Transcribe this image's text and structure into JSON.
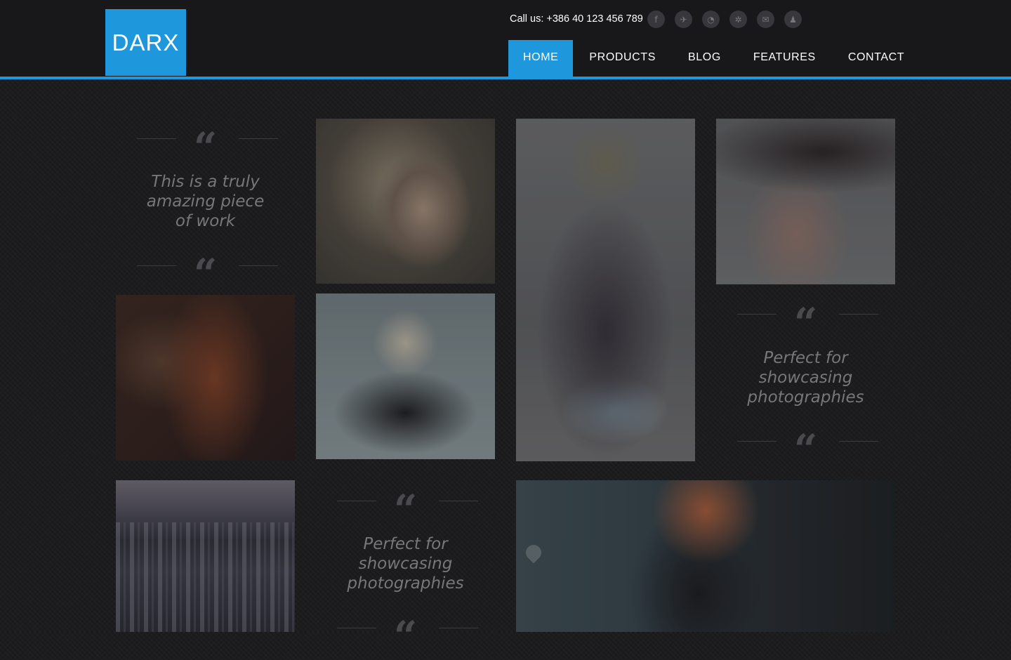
{
  "header": {
    "logo": "DARX",
    "call_us": "Call us: +386 40 123 456 789",
    "social_icons": [
      "facebook-icon",
      "twitter-icon",
      "rss-icon",
      "flickr-icon",
      "email-icon",
      "myspace-icon"
    ],
    "social_glyphs": [
      "f",
      "✈",
      "◔",
      "✲",
      "✉",
      "♟"
    ]
  },
  "nav": {
    "items": [
      "HOME",
      "PRODUCTS",
      "BLOG",
      "FEATURES",
      "CONTACT"
    ],
    "active": "HOME"
  },
  "quotes": [
    {
      "text_lines": [
        "This is a truly",
        "amazing piece",
        "of work"
      ]
    },
    {
      "text_lines": [
        "Perfect for",
        "showcasing",
        "photographies"
      ]
    },
    {
      "text_lines": [
        "Perfect for",
        "showcasing",
        "photographies"
      ]
    }
  ],
  "colors": {
    "accent": "#1f97dd",
    "header_bg": "#18181b",
    "page_bg": "#1c1c1e",
    "quote_text": "#77777b"
  }
}
